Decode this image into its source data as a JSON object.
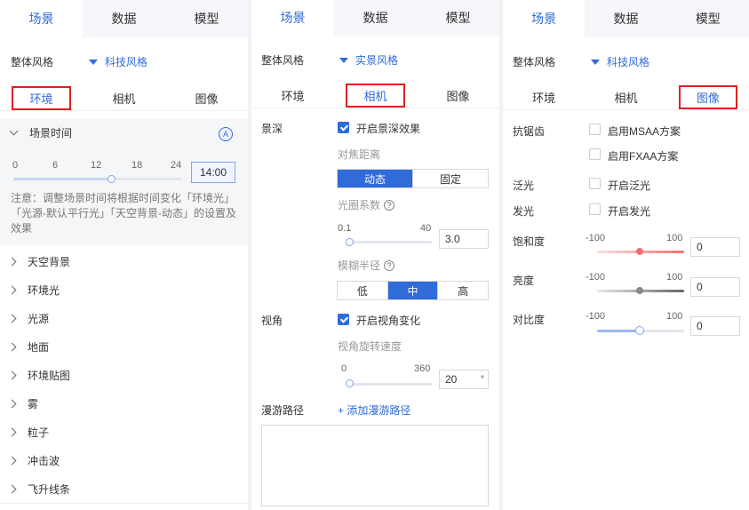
{
  "top_tabs": [
    "场景",
    "数据",
    "模型"
  ],
  "style_label": "整体风格",
  "sub_tabs": [
    "环境",
    "相机",
    "图像"
  ],
  "panel1": {
    "style_value": "科技风格",
    "section": "场景时间",
    "time_ticks": [
      "0",
      "6",
      "12",
      "18",
      "24"
    ],
    "time_value": "14:00",
    "time_progress": 0.5833,
    "note": "注意：调整场景时间将根据时间变化「环境光」「光源-默认平行光」「天空背景-动态」的设置及效果",
    "items": [
      "天空背景",
      "环境光",
      "光源",
      "地面",
      "环境贴图",
      "雾",
      "粒子",
      "冲击波",
      "飞升线条"
    ]
  },
  "panel2": {
    "style_value": "实景风格",
    "depth_label": "景深",
    "depth_checkbox": "开启景深效果",
    "focus_label": "对焦距离",
    "focus_options": [
      "动态",
      "固定"
    ],
    "aperture_label": "光圈系数",
    "aperture_min": "0.1",
    "aperture_max": "40",
    "aperture_value": "3.0",
    "blur_label": "模糊半径",
    "blur_options": [
      "低",
      "中",
      "高"
    ],
    "view_label": "视角",
    "view_checkbox": "开启视角变化",
    "rotate_label": "视角旋转速度",
    "rotate_min": "0",
    "rotate_max": "360",
    "rotate_value": "20",
    "rotate_unit": "°",
    "path_label": "漫游路径",
    "path_add": "+ 添加漫游路径"
  },
  "panel3": {
    "style_value": "科技风格",
    "aa_label": "抗锯齿",
    "msaa": "启用MSAA方案",
    "fxaa": "启用FXAA方案",
    "bloom_label": "泛光",
    "bloom": "开启泛光",
    "glow_label": "发光",
    "glow": "开启发光",
    "saturation_label": "饱和度",
    "brightness_label": "亮度",
    "contrast_label": "对比度",
    "min": "-100",
    "max": "100",
    "saturation_value": "0",
    "brightness_value": "0",
    "contrast_value": "0"
  },
  "colors": {
    "accent": "#2f6bd9",
    "highlight": "#e02020",
    "saturation": "#f07070",
    "brightness": "#888888",
    "contrast": "#9fb8f0"
  }
}
